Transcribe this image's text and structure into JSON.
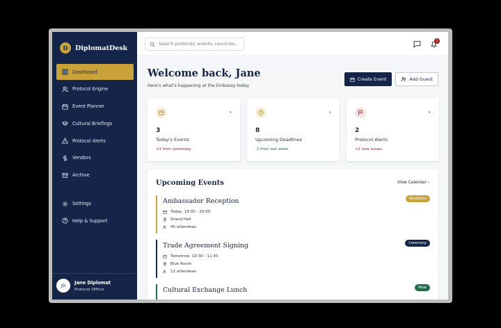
{
  "brand": {
    "logo_letter": "D",
    "name": "DiplomatDesk"
  },
  "sidebar": {
    "items": [
      {
        "label": "Dashboard",
        "icon": "grid-icon",
        "active": true
      },
      {
        "label": "Protocol Engine",
        "icon": "users-icon"
      },
      {
        "label": "Event Planner",
        "icon": "calendar-icon"
      },
      {
        "label": "Cultural Briefings",
        "icon": "graduation-cap-icon"
      },
      {
        "label": "Protocol Alerts",
        "icon": "warning-icon"
      },
      {
        "label": "Vendors",
        "icon": "dollar-icon"
      },
      {
        "label": "Archive",
        "icon": "archive-icon"
      }
    ],
    "bottom_items": [
      {
        "label": "Settings",
        "icon": "gear-icon"
      },
      {
        "label": "Help & Support",
        "icon": "help-icon"
      }
    ]
  },
  "user": {
    "initials": "JD",
    "name": "Jane Diplomat",
    "role": "Protocol Officer"
  },
  "topbar": {
    "search_placeholder": "Search protocols, events, countries...",
    "notification_count": "2"
  },
  "header": {
    "title": "Welcome back, Jane",
    "subtitle": "Here's what's happening at the Embassy today",
    "create_event_label": "Create Event",
    "add_guest_label": "Add Guest"
  },
  "stats": [
    {
      "value": "3",
      "label": "Today's Events",
      "change": "+1 from yesterday",
      "icon": "calendar-icon",
      "color": "#b8860b",
      "change_color": "#9b1c1c"
    },
    {
      "value": "8",
      "label": "Upcoming Deadlines",
      "change": "-2 from last week",
      "icon": "clock-icon",
      "color": "#b8860b",
      "change_color": "#1f6b4a"
    },
    {
      "value": "2",
      "label": "Protocol Alerts",
      "change": "+2 new issues",
      "icon": "flag-icon",
      "color": "#9b1c1c",
      "change_color": "#9b1c1c"
    }
  ],
  "events": {
    "title": "Upcoming Events",
    "view_calendar_label": "View Calendar",
    "items": [
      {
        "name": "Ambassador Reception",
        "time": "Today, 18:00 - 20:00",
        "location": "Grand Hall",
        "attendees": "45 attendees",
        "tag": "Reception",
        "color": "#c9a23a"
      },
      {
        "name": "Trade Agreement Signing",
        "time": "Tomorrow, 10:30 - 11:30",
        "location": "Blue Room",
        "attendees": "12 attendees",
        "tag": "Ceremony",
        "color": "#15254a"
      },
      {
        "name": "Cultural Exchange Lunch",
        "time": "",
        "location": "",
        "attendees": "",
        "tag": "Meal",
        "color": "#1f6b4a"
      }
    ]
  }
}
